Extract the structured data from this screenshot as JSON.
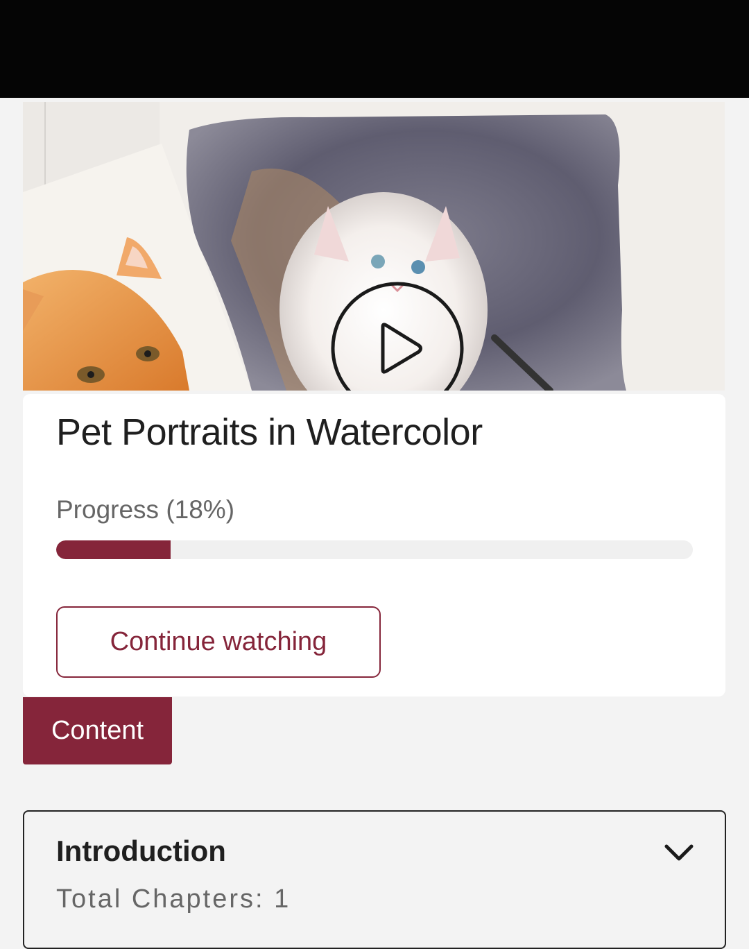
{
  "course": {
    "title": "Pet Portraits in Watercolor",
    "progress_label": "Progress (18%)",
    "progress_fraction": 0.18,
    "continue_label": "Continue watching"
  },
  "tabs": {
    "content_label": "Content"
  },
  "sections": [
    {
      "title": "Introduction",
      "meta": "Total Chapters: 1"
    }
  ],
  "colors": {
    "accent": "#85253a",
    "background": "#f3f3f3",
    "top_bar": "#050505"
  },
  "icons": {
    "play": "play-circle-icon",
    "expand": "chevron-down-icon"
  }
}
